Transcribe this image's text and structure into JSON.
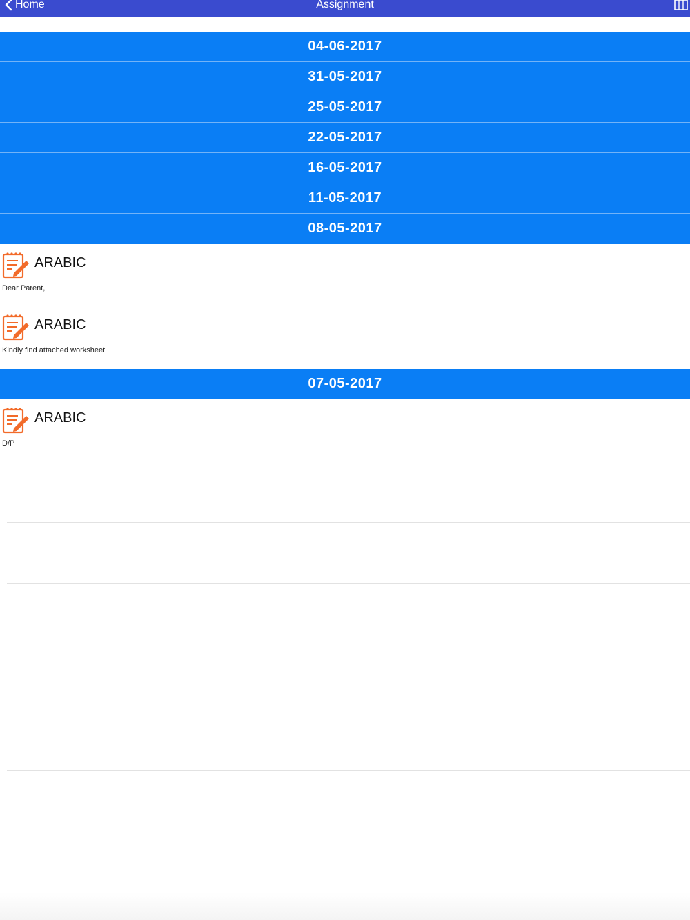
{
  "nav": {
    "back_label": "Home",
    "title": "Assignment"
  },
  "colors": {
    "nav_bar": "#3a4bcf",
    "date_header": "#0a7ef5",
    "icon_accent": "#f26b2a"
  },
  "icons": {
    "back": "chevron-left-icon",
    "nav_right": "columns-icon",
    "assignment": "notepad-pencil-icon"
  },
  "dates": [
    "04-06-2017",
    "31-05-2017",
    "25-05-2017",
    "22-05-2017",
    "16-05-2017",
    "11-05-2017",
    "08-05-2017",
    "07-05-2017"
  ],
  "assignments": [
    {
      "subject": "ARABIC",
      "description": "Dear Parent,"
    },
    {
      "subject": "ARABIC",
      "description": "Kindly find attached worksheet"
    },
    {
      "subject": "ARABIC",
      "description": "D/P"
    }
  ]
}
